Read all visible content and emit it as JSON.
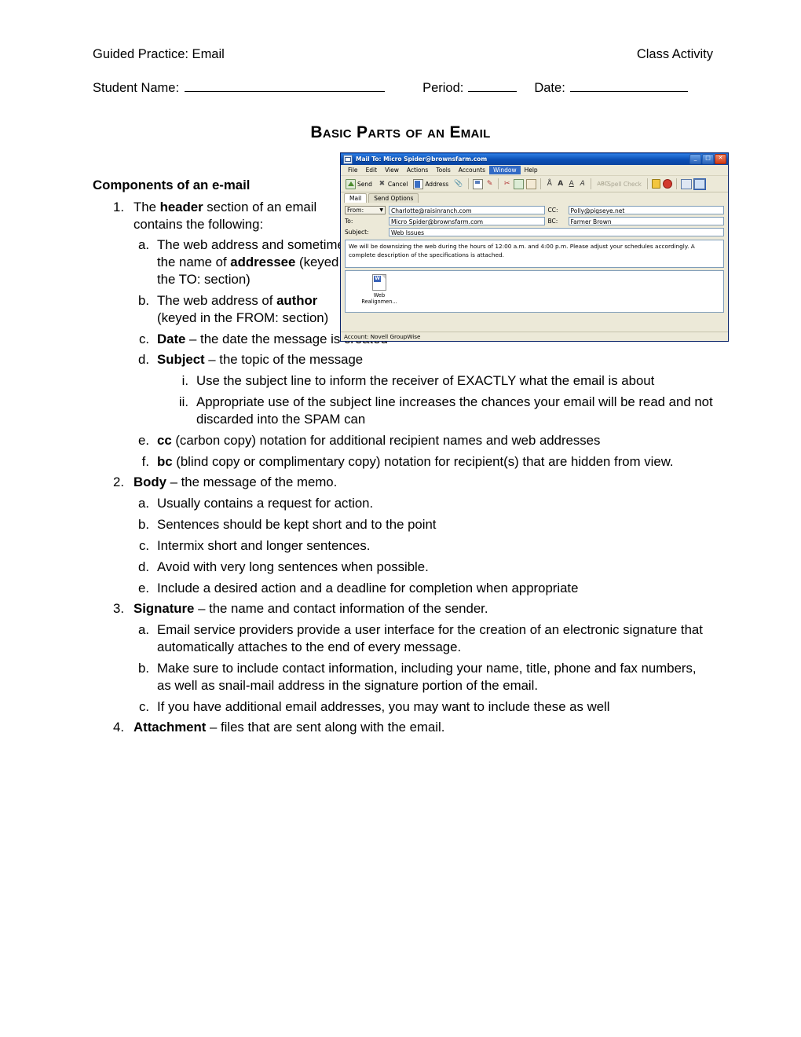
{
  "header": {
    "left": "Guided Practice:  Email",
    "right": "Class Activity",
    "student_label": "Student Name:",
    "period_label": "Period:",
    "date_label": "Date:"
  },
  "title": "Basic Parts of an Email",
  "outline": {
    "section_heading": "Components of an e-mail",
    "items": [
      {
        "marker": "1.",
        "level": 1,
        "narrow": true,
        "html": "The <b>header</b> section of an email contains the following:"
      },
      {
        "marker": "a.",
        "level": 2,
        "narrow": true,
        "html": "The web address and sometimes the name of <b>addressee</b> (keyed in the TO: section)"
      },
      {
        "marker": "b.",
        "level": 2,
        "narrow": true,
        "html": "The web address of <b>author</b> (keyed in the FROM: section)"
      },
      {
        "marker": "c.",
        "level": 2,
        "narrow": false,
        "html": "<b>Date</b> &ndash; the date the message is created"
      },
      {
        "marker": "d.",
        "level": 2,
        "narrow": false,
        "html": "<b>Subject</b> &ndash; the topic of the message"
      },
      {
        "marker": "i.",
        "level": 3,
        "narrow": false,
        "html": "Use the subject line to inform the receiver of EXACTLY what the email is about"
      },
      {
        "marker": "ii.",
        "level": 3,
        "narrow": false,
        "html": "Appropriate use of the subject line increases the chances your email will be read and not discarded into the SPAM can"
      },
      {
        "marker": "e.",
        "level": 2,
        "narrow": false,
        "html": "<b>cc</b> (carbon copy) notation for additional recipient names and web addresses"
      },
      {
        "marker": "f.",
        "level": 2,
        "narrow": false,
        "html": "<b>bc</b> (blind copy or complimentary copy) notation for recipient(s) that are hidden from view."
      },
      {
        "marker": "2.",
        "level": 1,
        "narrow": false,
        "html": "<b>Body</b> &ndash; the message of the memo."
      },
      {
        "marker": "a.",
        "level": 2,
        "narrow": false,
        "html": "Usually contains a request for action."
      },
      {
        "marker": "b.",
        "level": 2,
        "narrow": false,
        "html": "Sentences should be kept short and to the point"
      },
      {
        "marker": "c.",
        "level": 2,
        "narrow": false,
        "html": "Intermix short and longer sentences."
      },
      {
        "marker": "d.",
        "level": 2,
        "narrow": false,
        "html": "Avoid with very long sentences when possible."
      },
      {
        "marker": "e.",
        "level": 2,
        "narrow": false,
        "html": "Include a desired action and a deadline for completion when appropriate"
      },
      {
        "marker": "3.",
        "level": 1,
        "narrow": false,
        "html": "<b>Signature</b> &ndash; the name and contact information of the sender."
      },
      {
        "marker": "a.",
        "level": 2,
        "narrow": false,
        "html": "Email service providers provide a user interface for the creation of an electronic signature that automatically attaches to the end of every message."
      },
      {
        "marker": "b.",
        "level": 2,
        "narrow": false,
        "html": "Make sure to include contact information, including your name, title, phone and fax numbers, as well as snail-mail address in the signature portion of the email."
      },
      {
        "marker": "c.",
        "level": 2,
        "narrow": false,
        "html": "If you have additional email addresses, you may want to include these as well"
      },
      {
        "marker": "4.",
        "level": 1,
        "narrow": false,
        "html": "<b>Attachment</b> &ndash; files that are sent along with the email."
      }
    ]
  },
  "mail_window": {
    "title": "Mail To: Micro Spider@brownsfarm.com",
    "window_buttons": {
      "minimize": "_",
      "maximize": "□",
      "close": "✕"
    },
    "menu": [
      "File",
      "Edit",
      "View",
      "Actions",
      "Tools",
      "Accounts",
      "Window",
      "Help"
    ],
    "active_menu": "Window",
    "toolbar": {
      "send": "Send",
      "cancel": "Cancel",
      "address": "Address",
      "spell_check": "Spell Check"
    },
    "tabs": [
      "Mail",
      "Send Options"
    ],
    "active_tab": "Mail",
    "fields": {
      "from_label": "From:",
      "from_value": "Charlotte@raisinranch.com",
      "to_label": "To:",
      "to_value": "Micro Spider@brownsfarm.com",
      "cc_label": "CC:",
      "cc_value": "Polly@pigseye.net",
      "bc_label": "BC:",
      "bc_value": "Farmer Brown",
      "subject_label": "Subject:",
      "subject_value": "Web Issues"
    },
    "message": "We will be downsizing the web during the hours of 12:00 a.m. and 4:00 p.m.  Please adjust your schedules accordingly.  A complete description of the specifications is attached.",
    "attachment": {
      "name": "Web Realignmen..."
    },
    "status": "Account: Novell GroupWise",
    "colors": {
      "titlebar": "#0a4fb5",
      "chrome": "#ece9d8",
      "accent": "#316ac5",
      "close": "#cf3a14"
    }
  }
}
